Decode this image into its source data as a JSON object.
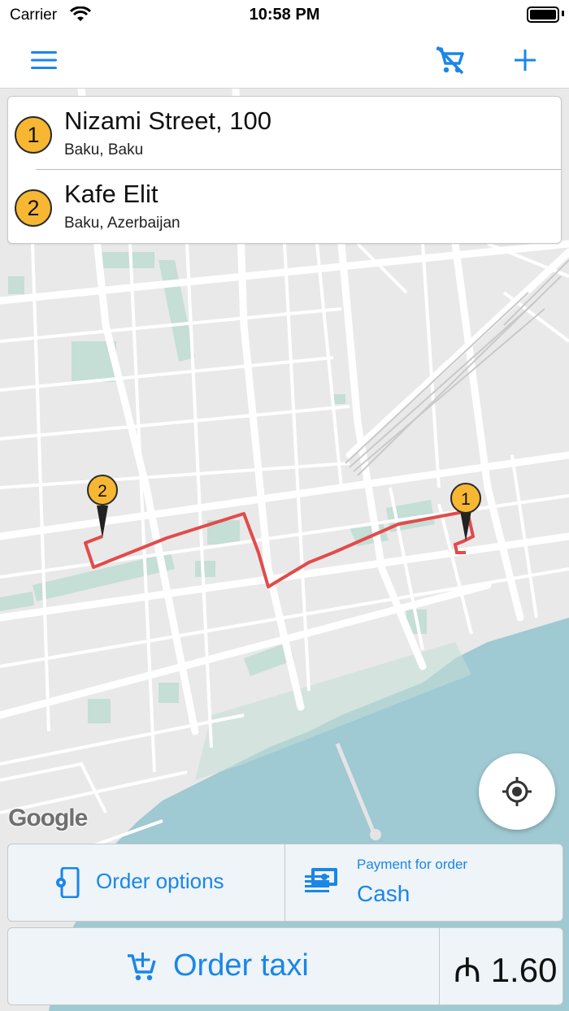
{
  "status_bar": {
    "carrier": "Carrier",
    "time": "10:58 PM"
  },
  "nav": {
    "menu_icon": "menu-icon",
    "cart_icon": "cart-off-icon",
    "add_icon": "plus-icon"
  },
  "route": {
    "stops": [
      {
        "number": "1",
        "title": "Nizami Street, 100",
        "subtitle": "Baku, Baku"
      },
      {
        "number": "2",
        "title": "Kafe Elit",
        "subtitle": "Baku, Azerbaijan"
      }
    ]
  },
  "map": {
    "attribution": "Google",
    "route_color": "#e24b4b",
    "pin_color": "#f7b733"
  },
  "options": {
    "order_options_label": "Order options",
    "payment_caption": "Payment for order",
    "payment_value": "Cash"
  },
  "order": {
    "order_label": "Order taxi",
    "price": "₼ 1.60"
  },
  "colors": {
    "accent": "#1a86e8",
    "water": "#9fc9d3",
    "park": "#c5ded6"
  }
}
